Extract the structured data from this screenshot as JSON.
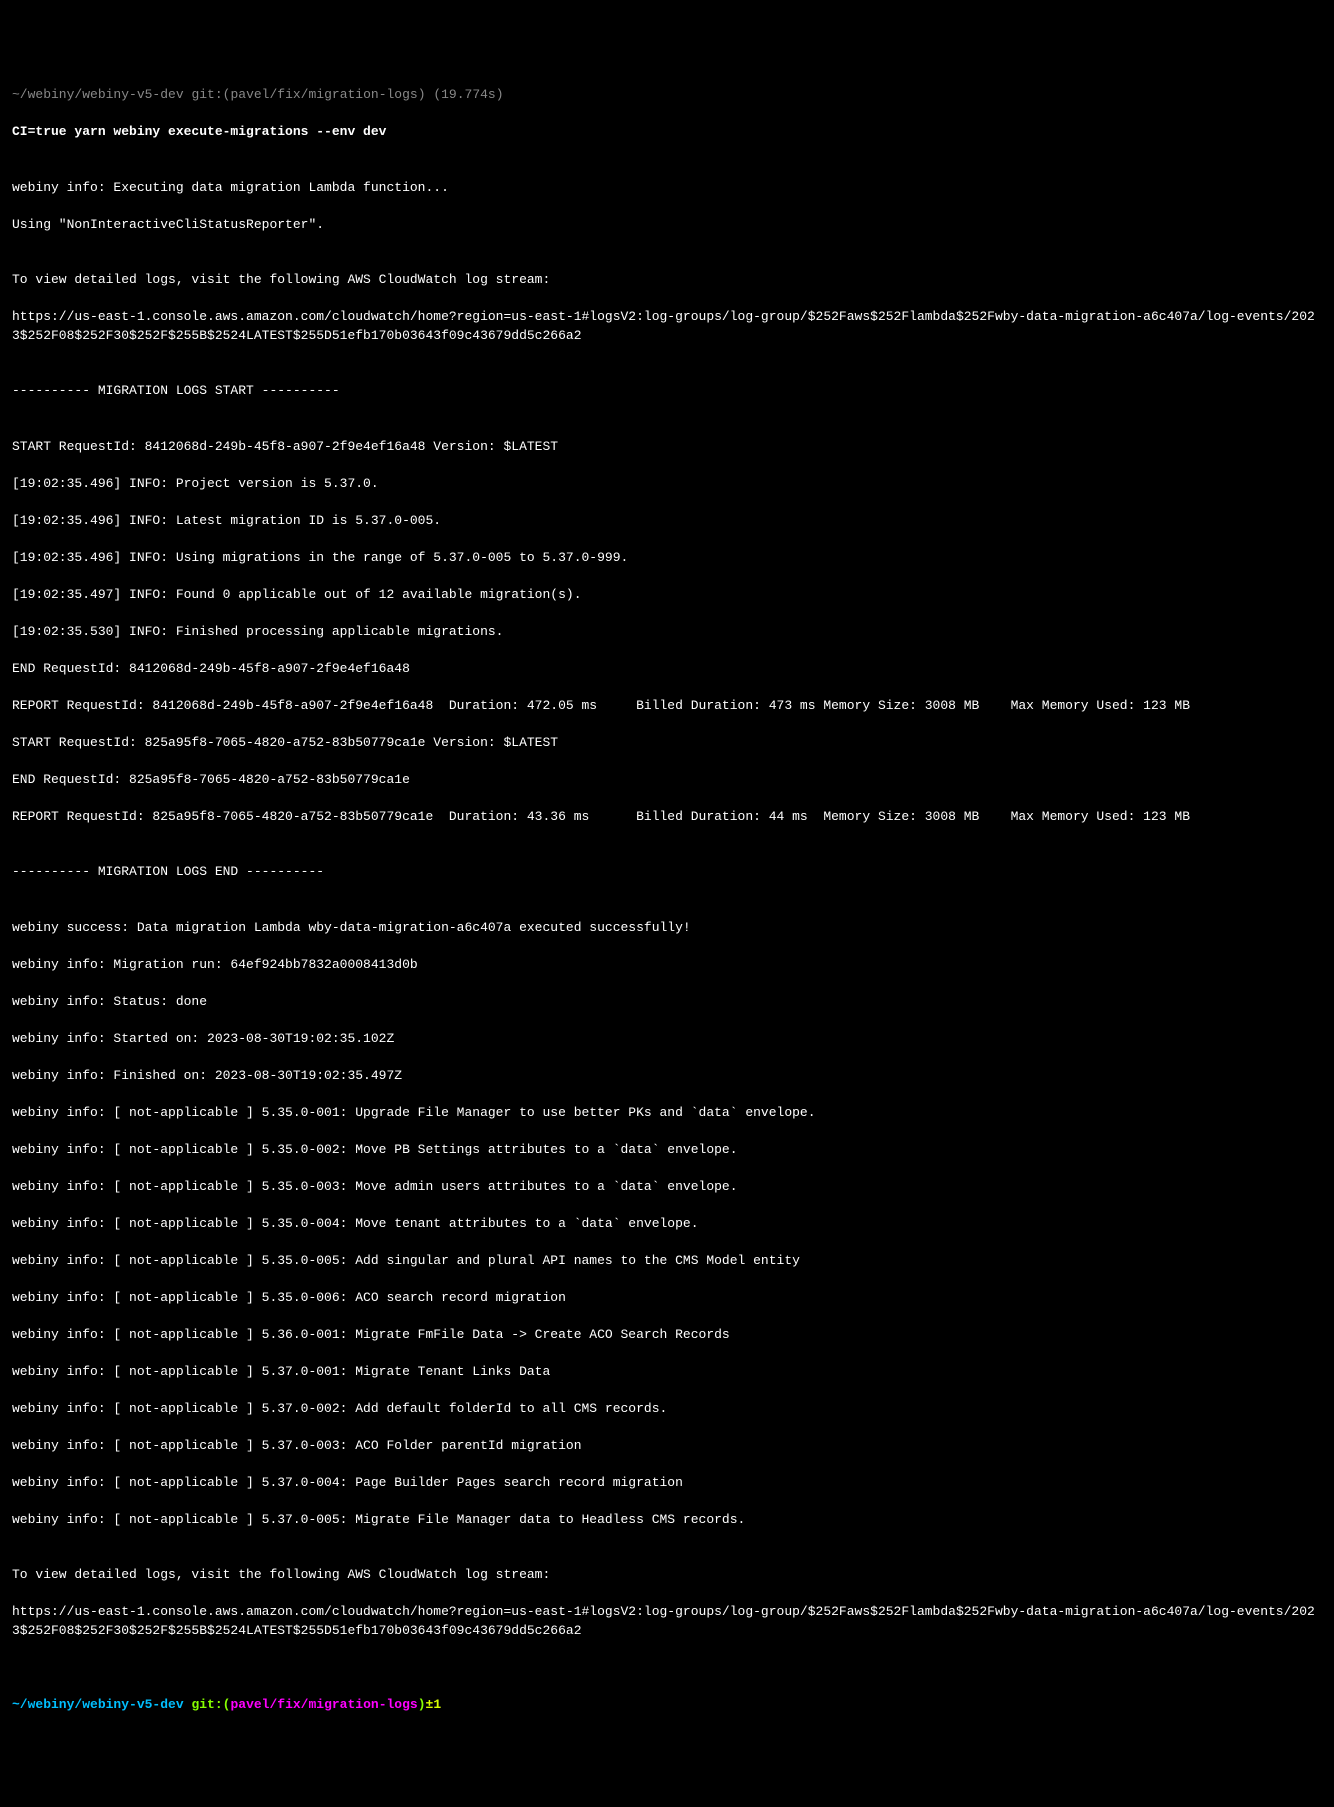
{
  "header": {
    "path": "~/webiny/webiny-v5-dev",
    "git_label": "git:",
    "branch": "(pavel/fix/migration-logs)",
    "timer": "(19.774s)"
  },
  "command": "CI=true yarn webiny execute-migrations --env dev",
  "intro": {
    "l1": "webiny info: Executing data migration Lambda function...",
    "l2": "Using \"NonInteractiveCliStatusReporter\"."
  },
  "view_logs_1": {
    "msg": "To view detailed logs, visit the following AWS CloudWatch log stream:",
    "url": "https://us-east-1.console.aws.amazon.com/cloudwatch/home?region=us-east-1#logsV2:log-groups/log-group/$252Faws$252Flambda$252Fwby-data-migration-a6c407a/log-events/2023$252F08$252F30$252F$255B$2524LATEST$255D51efb170b03643f09c43679dd5c266a2"
  },
  "logs_start": "---------- MIGRATION LOGS START ----------",
  "logs": {
    "l1": "START RequestId: 8412068d-249b-45f8-a907-2f9e4ef16a48 Version: $LATEST",
    "l2": "[19:02:35.496] INFO: Project version is 5.37.0.",
    "l3": "[19:02:35.496] INFO: Latest migration ID is 5.37.0-005.",
    "l4": "[19:02:35.496] INFO: Using migrations in the range of 5.37.0-005 to 5.37.0-999.",
    "l5": "[19:02:35.497] INFO: Found 0 applicable out of 12 available migration(s).",
    "l6": "[19:02:35.530] INFO: Finished processing applicable migrations.",
    "l7": "END RequestId: 8412068d-249b-45f8-a907-2f9e4ef16a48",
    "l8": "REPORT RequestId: 8412068d-249b-45f8-a907-2f9e4ef16a48  Duration: 472.05 ms     Billed Duration: 473 ms Memory Size: 3008 MB    Max Memory Used: 123 MB",
    "l9": "START RequestId: 825a95f8-7065-4820-a752-83b50779ca1e Version: $LATEST",
    "l10": "END RequestId: 825a95f8-7065-4820-a752-83b50779ca1e",
    "l11": "REPORT RequestId: 825a95f8-7065-4820-a752-83b50779ca1e  Duration: 43.36 ms      Billed Duration: 44 ms  Memory Size: 3008 MB    Max Memory Used: 123 MB"
  },
  "logs_end": "---------- MIGRATION LOGS END ----------",
  "result": {
    "success": "webiny success: Data migration Lambda wby-data-migration-a6c407a executed successfully!",
    "run": "webiny info: Migration run: 64ef924bb7832a0008413d0b",
    "status": "webiny info: Status: done",
    "started": "webiny info: Started on: 2023-08-30T19:02:35.102Z",
    "finished": "webiny info: Finished on: 2023-08-30T19:02:35.497Z"
  },
  "migrations": {
    "m1": "webiny info: [ not-applicable ] 5.35.0-001: Upgrade File Manager to use better PKs and `data` envelope.",
    "m2": "webiny info: [ not-applicable ] 5.35.0-002: Move PB Settings attributes to a `data` envelope.",
    "m3": "webiny info: [ not-applicable ] 5.35.0-003: Move admin users attributes to a `data` envelope.",
    "m4": "webiny info: [ not-applicable ] 5.35.0-004: Move tenant attributes to a `data` envelope.",
    "m5": "webiny info: [ not-applicable ] 5.35.0-005: Add singular and plural API names to the CMS Model entity",
    "m6": "webiny info: [ not-applicable ] 5.35.0-006: ACO search record migration",
    "m7": "webiny info: [ not-applicable ] 5.36.0-001: Migrate FmFile Data -> Create ACO Search Records",
    "m8": "webiny info: [ not-applicable ] 5.37.0-001: Migrate Tenant Links Data",
    "m9": "webiny info: [ not-applicable ] 5.37.0-002: Add default folderId to all CMS records.",
    "m10": "webiny info: [ not-applicable ] 5.37.0-003: ACO Folder parentId migration",
    "m11": "webiny info: [ not-applicable ] 5.37.0-004: Page Builder Pages search record migration",
    "m12": "webiny info: [ not-applicable ] 5.37.0-005: Migrate File Manager data to Headless CMS records."
  },
  "view_logs_2": {
    "msg": "To view detailed logs, visit the following AWS CloudWatch log stream:",
    "url": "https://us-east-1.console.aws.amazon.com/cloudwatch/home?region=us-east-1#logsV2:log-groups/log-group/$252Faws$252Flambda$252Fwby-data-migration-a6c407a/log-events/2023$252F08$252F30$252F$255B$2524LATEST$255D51efb170b03643f09c43679dd5c266a2"
  },
  "prompt": {
    "path": "~/webiny/webiny-v5-dev",
    "git_label": "git:(",
    "branch": "pavel/fix/migration-logs",
    "close": ")",
    "indicator": "±1"
  }
}
